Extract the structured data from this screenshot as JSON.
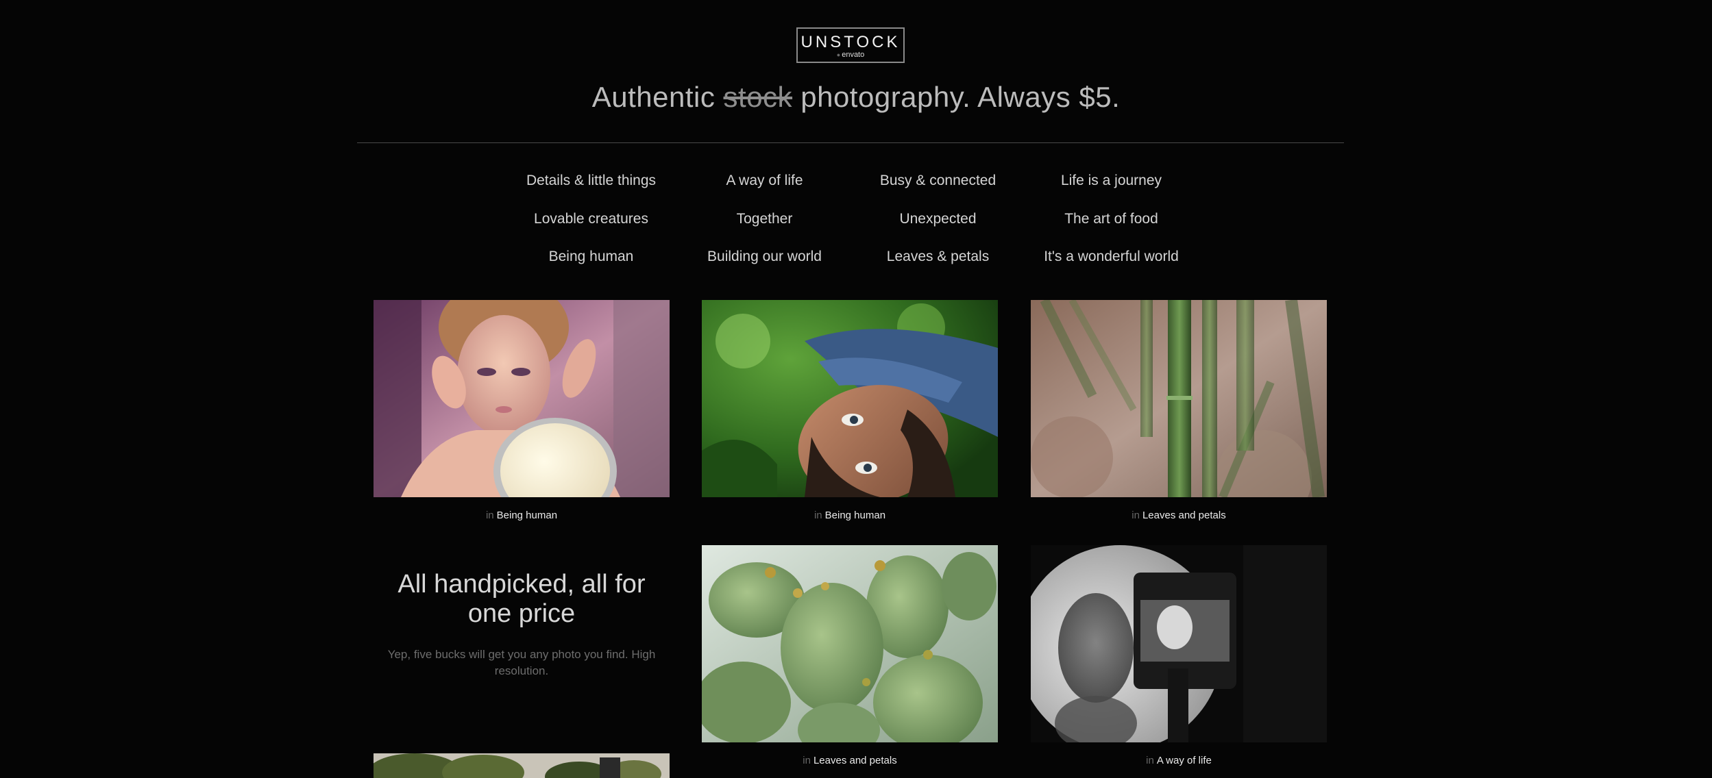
{
  "header": {
    "logo_main": "UNSTOCK",
    "logo_sub": "envato",
    "tagline_start": "Authentic ",
    "tagline_strike": "stock",
    "tagline_end": " photography. Always $5."
  },
  "categories": [
    "Details & little things",
    "A way of life",
    "Busy & connected",
    "Life is a journey",
    "Lovable creatures",
    "Together",
    "Unexpected",
    "The art of food",
    "Being human",
    "Building our world",
    "Leaves & petals",
    "It's a wonderful world"
  ],
  "photos": [
    {
      "prefix": "in",
      "category": "Being human",
      "subject": "woman-with-mirror"
    },
    {
      "prefix": "in",
      "category": "Being human",
      "subject": "man-lying-in-grass"
    },
    {
      "prefix": "in",
      "category": "Leaves and petals",
      "subject": "bamboo"
    },
    {
      "prefix": "in",
      "category": "Leaves and petals",
      "subject": "cactus"
    },
    {
      "prefix": "in",
      "category": "A way of life",
      "subject": "camera-viewfinder"
    }
  ],
  "promo": {
    "title": "All handpicked, all for one price",
    "text": "Yep, five bucks will get you any photo you find. High resolution."
  },
  "colors": {
    "background": "#050505",
    "divider": "#4a4a4a",
    "text": "#d5d5d5",
    "muted": "#6d6d6d"
  }
}
